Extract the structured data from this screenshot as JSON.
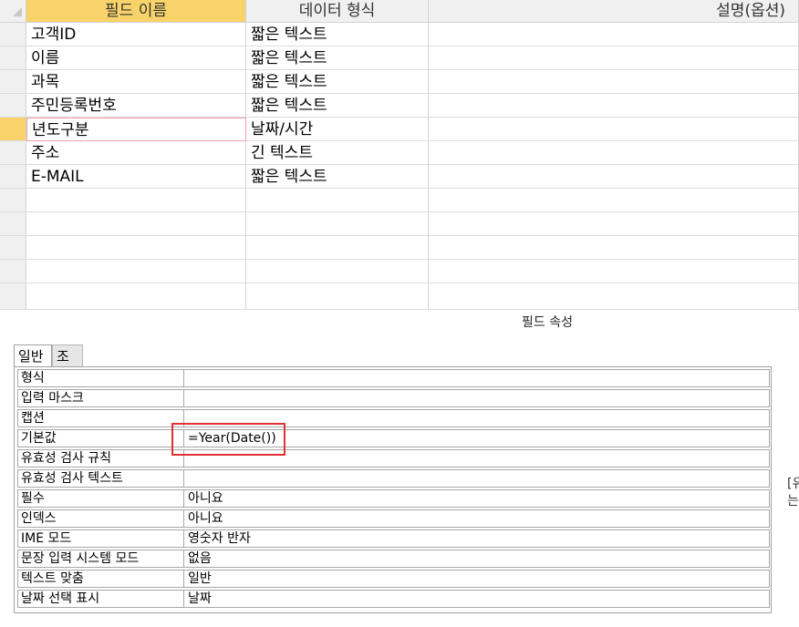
{
  "grid": {
    "headers": {
      "field_name": "필드 이름",
      "data_type": "데이터 형식",
      "description": "설명(옵션)"
    },
    "rows": [
      {
        "field_name": "고객ID",
        "data_type": "짧은 텍스트",
        "description": ""
      },
      {
        "field_name": "이름",
        "data_type": "짧은 텍스트",
        "description": ""
      },
      {
        "field_name": "과목",
        "data_type": "짧은 텍스트",
        "description": ""
      },
      {
        "field_name": "주민등록번호",
        "data_type": "짧은 텍스트",
        "description": ""
      },
      {
        "field_name": "년도구분",
        "data_type": "날짜/시간",
        "description": ""
      },
      {
        "field_name": "주소",
        "data_type": "긴 텍스트",
        "description": ""
      },
      {
        "field_name": "E-MAIL",
        "data_type": "짧은 텍스트",
        "description": ""
      }
    ],
    "current_row": 5
  },
  "properties": {
    "title": "필드 속성",
    "tabs": [
      {
        "label": "일반"
      },
      {
        "label": "조회"
      }
    ],
    "items": [
      {
        "label": "형식",
        "value": ""
      },
      {
        "label": "입력 마스크",
        "value": ""
      },
      {
        "label": "캡션",
        "value": ""
      },
      {
        "label": "기본값",
        "value": "=Year(Date())"
      },
      {
        "label": "유효성 검사 규칙",
        "value": ""
      },
      {
        "label": "유효성 검사 텍스트",
        "value": ""
      },
      {
        "label": "필수",
        "value": "아니요"
      },
      {
        "label": "인덱스",
        "value": "아니요"
      },
      {
        "label": "IME 모드",
        "value": "영숫자 반자"
      },
      {
        "label": "문장 입력 시스템 모드",
        "value": "없음"
      },
      {
        "label": "텍스트 맞춤",
        "value": "일반"
      },
      {
        "label": "날짜 선택 표시",
        "value": "날짜"
      }
    ],
    "side_hint": {
      "line1": "[유",
      "line2": "는"
    }
  },
  "colors": {
    "current_row_selector": "#f8d36a",
    "highlight_box": "#e03030",
    "header_bg": "#f0f0f0"
  }
}
